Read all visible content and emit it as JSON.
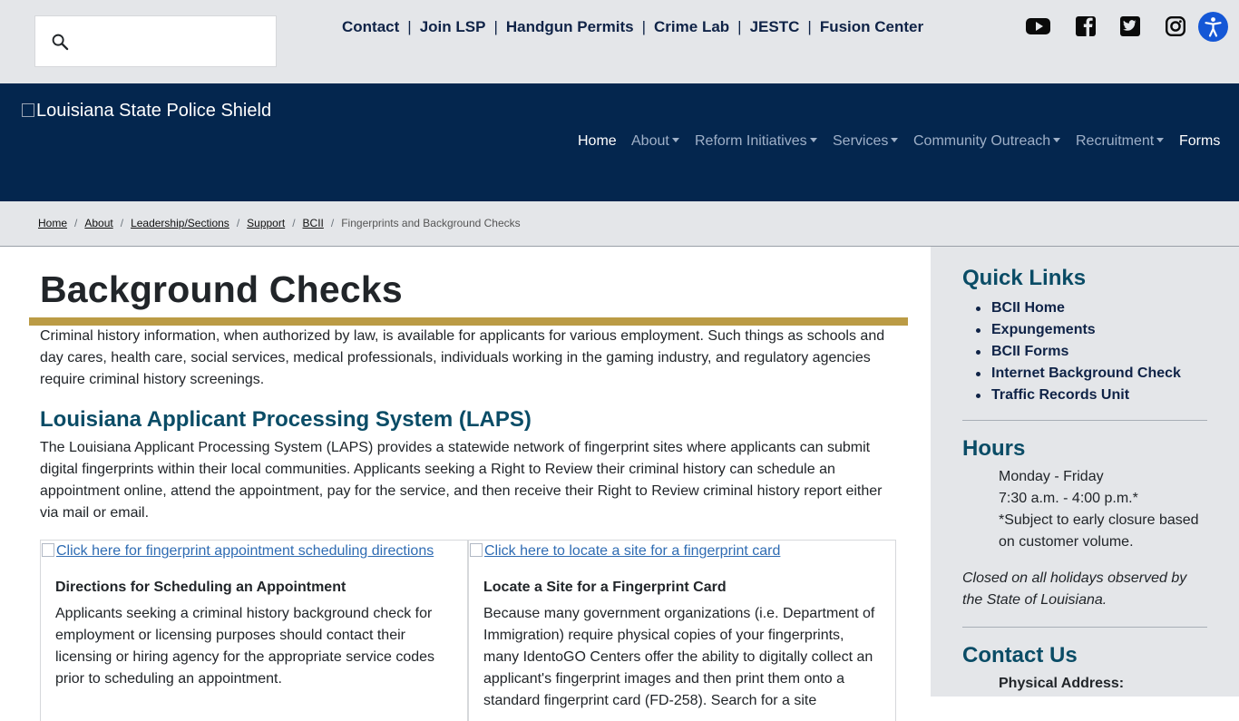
{
  "search": {
    "icon": "search-icon",
    "placeholder": ""
  },
  "utility_links": [
    "Contact",
    "Join LSP",
    "Handgun Permits",
    "Crime Lab",
    "JESTC",
    "Fusion Center"
  ],
  "utility_separator": "|",
  "social": [
    "youtube-icon",
    "facebook-icon",
    "twitter-icon",
    "instagram-icon"
  ],
  "header": {
    "logo_alt": "Louisiana State Police Shield",
    "nav": [
      {
        "label": "Home",
        "dropdown": false,
        "active": true
      },
      {
        "label": "About",
        "dropdown": true,
        "active": false
      },
      {
        "label": "Reform Initiatives",
        "dropdown": true,
        "active": false
      },
      {
        "label": "Services",
        "dropdown": true,
        "active": false
      },
      {
        "label": "Community Outreach",
        "dropdown": true,
        "active": false
      },
      {
        "label": "Recruitment",
        "dropdown": true,
        "active": false
      },
      {
        "label": "Forms",
        "dropdown": false,
        "active": true
      }
    ]
  },
  "breadcrumb": {
    "links": [
      "Home",
      "About",
      "Leadership/Sections",
      "Support",
      "BCII"
    ],
    "separator": "/",
    "current": "Fingerprints and Background Checks"
  },
  "main": {
    "title": "Background Checks",
    "intro": "Criminal history information, when authorized by law, is available for applicants for various employment. Such things as schools and day cares, health care, social services, medical professionals, individuals working in the gaming industry, and regulatory agencies require criminal history screenings.",
    "laps_heading": "Louisiana Applicant Processing System (LAPS)",
    "laps_text": "The Louisiana Applicant Processing System (LAPS) provides a statewide network of fingerprint sites where applicants can submit digital fingerprints within their local communities. Applicants seeking a Right to Review their criminal history can schedule an appointment online, attend the appointment, pay for the service, and then receive their Right to Review criminal history report either via mail or email.",
    "cards": [
      {
        "img_alt": "Click here for fingerprint appointment scheduling directions",
        "title": "Directions for Scheduling an Appointment",
        "text": "Applicants seeking a criminal history background check for employment or licensing purposes should contact their licensing or hiring agency for the appropriate service codes prior to scheduling an appointment."
      },
      {
        "img_alt": "Click here to locate a site for a fingerprint card",
        "title": "Locate a Site for a Fingerprint Card",
        "text": "Because many government organizations (i.e. Department of Immigration) require physical copies of your fingerprints, many IdentoGO Centers offer the ability to digitally collect an applicant's fingerprint images and then print them onto a standard fingerprint card (FD-258). Search for a site"
      }
    ]
  },
  "sidebar": {
    "quick_links_title": "Quick Links",
    "quick_links": [
      "BCII Home",
      "Expungements",
      "BCII Forms",
      "Internet Background Check",
      "Traffic Records Unit"
    ],
    "hours_title": "Hours",
    "hours_lines": [
      "Monday - Friday",
      "7:30 a.m. - 4:00 p.m.*",
      "*Subject to early closure based on customer volume."
    ],
    "closed_note": "Closed on all holidays observed by the State of Louisiana.",
    "contact_title": "Contact Us",
    "physical_address_label": "Physical Address:"
  },
  "colors": {
    "navy": "#04264e",
    "gold": "#bb9b45",
    "teal_heading": "#0a4c66",
    "accessibility_blue": "#1457d6"
  }
}
